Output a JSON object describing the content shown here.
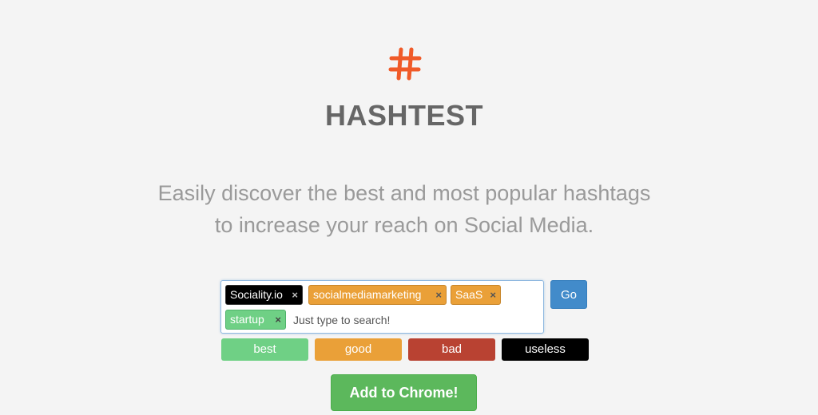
{
  "brand": {
    "logo_icon": "hashtag-icon",
    "logo_color": "#f05a28",
    "name": "HASHTEST"
  },
  "tagline": {
    "line1": "Easily discover the best and most popular hashtags",
    "line2": "to increase your reach on Social Media."
  },
  "search": {
    "tags": [
      {
        "label": "Sociality.io",
        "remove_glyph": "×",
        "color": "#000000"
      },
      {
        "label": "socialmediamarketing",
        "remove_glyph": "×",
        "color": "#eaa038"
      },
      {
        "label": "SaaS",
        "remove_glyph": "×",
        "color": "#eaa038"
      },
      {
        "label": "startup",
        "remove_glyph": "×",
        "color": "#6fd085"
      }
    ],
    "placeholder": "Just type to search!",
    "go_label": "Go",
    "go_color": "#428bca"
  },
  "legend": [
    {
      "label": "best",
      "color": "#6fd085"
    },
    {
      "label": "good",
      "color": "#eaa038"
    },
    {
      "label": "bad",
      "color": "#b94232"
    },
    {
      "label": "useless",
      "color": "#000000"
    }
  ],
  "cta": {
    "label": "Add to Chrome!",
    "color": "#5cb85c"
  }
}
